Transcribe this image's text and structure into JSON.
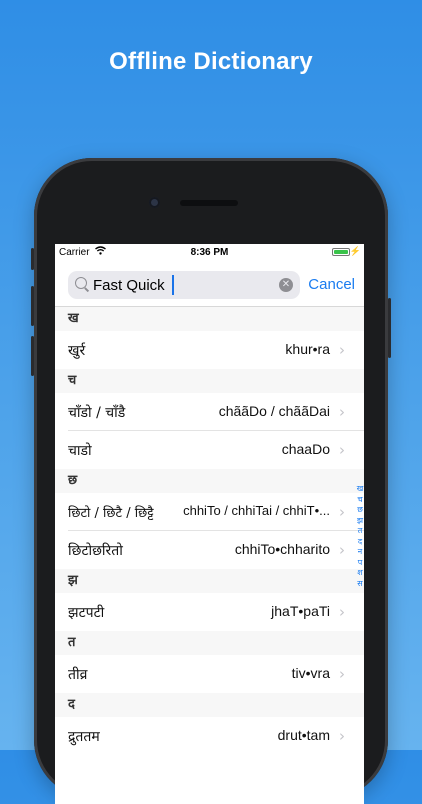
{
  "headline": "Offline Dictionary",
  "status": {
    "carrier": "Carrier",
    "time": "8:36 PM"
  },
  "search": {
    "value": "Fast Quick",
    "cancel_label": "Cancel"
  },
  "sections": [
    {
      "letter": "ख",
      "rows": [
        {
          "nepali": "खुर्र",
          "roman": "khur•ra"
        }
      ]
    },
    {
      "letter": "च",
      "rows": [
        {
          "nepali": "चाँडो / चाँडै",
          "roman": "chããDo / chããDai"
        },
        {
          "nepali": "चाडो",
          "roman": "chaaDo"
        }
      ]
    },
    {
      "letter": "छ",
      "rows": [
        {
          "nepali": "छिटो / छिटै / छिट्टै",
          "roman": "chhiTo / chhiTai / chhiT•..."
        },
        {
          "nepali": "छिटोछरितो",
          "roman": "chhiTo•chharito"
        }
      ]
    },
    {
      "letter": "झ",
      "rows": [
        {
          "nepali": "झटपटी",
          "roman": "jhaT•paTi"
        }
      ]
    },
    {
      "letter": "त",
      "rows": [
        {
          "nepali": "तीव्र",
          "roman": "tiv•vra"
        }
      ]
    },
    {
      "letter": "द",
      "rows": [
        {
          "nepali": "द्रुततम",
          "roman": "drut•tam"
        }
      ]
    }
  ],
  "index_letters": [
    "ख",
    "च",
    "छ",
    "झ",
    "त",
    "द",
    "न",
    "प",
    "श",
    "स"
  ],
  "colors": {
    "accent": "#1a7cf0",
    "background_top": "#2f8ee6",
    "background_bottom": "#66b3ef"
  },
  "icons": {
    "search": "search-icon",
    "clear": "clear-icon",
    "chevron": "chevron-right-icon",
    "wifi": "wifi-icon",
    "battery": "battery-icon"
  }
}
